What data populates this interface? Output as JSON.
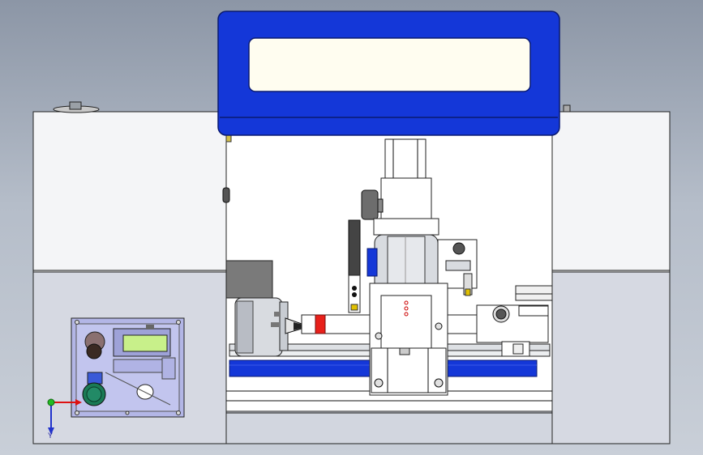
{
  "scene": {
    "colors": {
      "background_top": "#8c96a6",
      "background_bottom": "#c9cfd8",
      "cabinet_upper": "#f4f5f7",
      "cabinet_lower": "#d6d9e2",
      "hood_blue": "#1437d8",
      "window_cream": "#fffdf0",
      "control_panel": "#b3b6e6",
      "lcd_green": "#c8f08a",
      "chuck_silver": "#d8dbe0",
      "rail_blue": "#1437d8",
      "marker_red": "#e8201a",
      "knob_dark": "#3a2a22",
      "knob_green": "#1a7a55"
    },
    "lcd_text": "",
    "axis_triad": {
      "x_label": "",
      "y_label": "",
      "z_label": "Y"
    }
  }
}
